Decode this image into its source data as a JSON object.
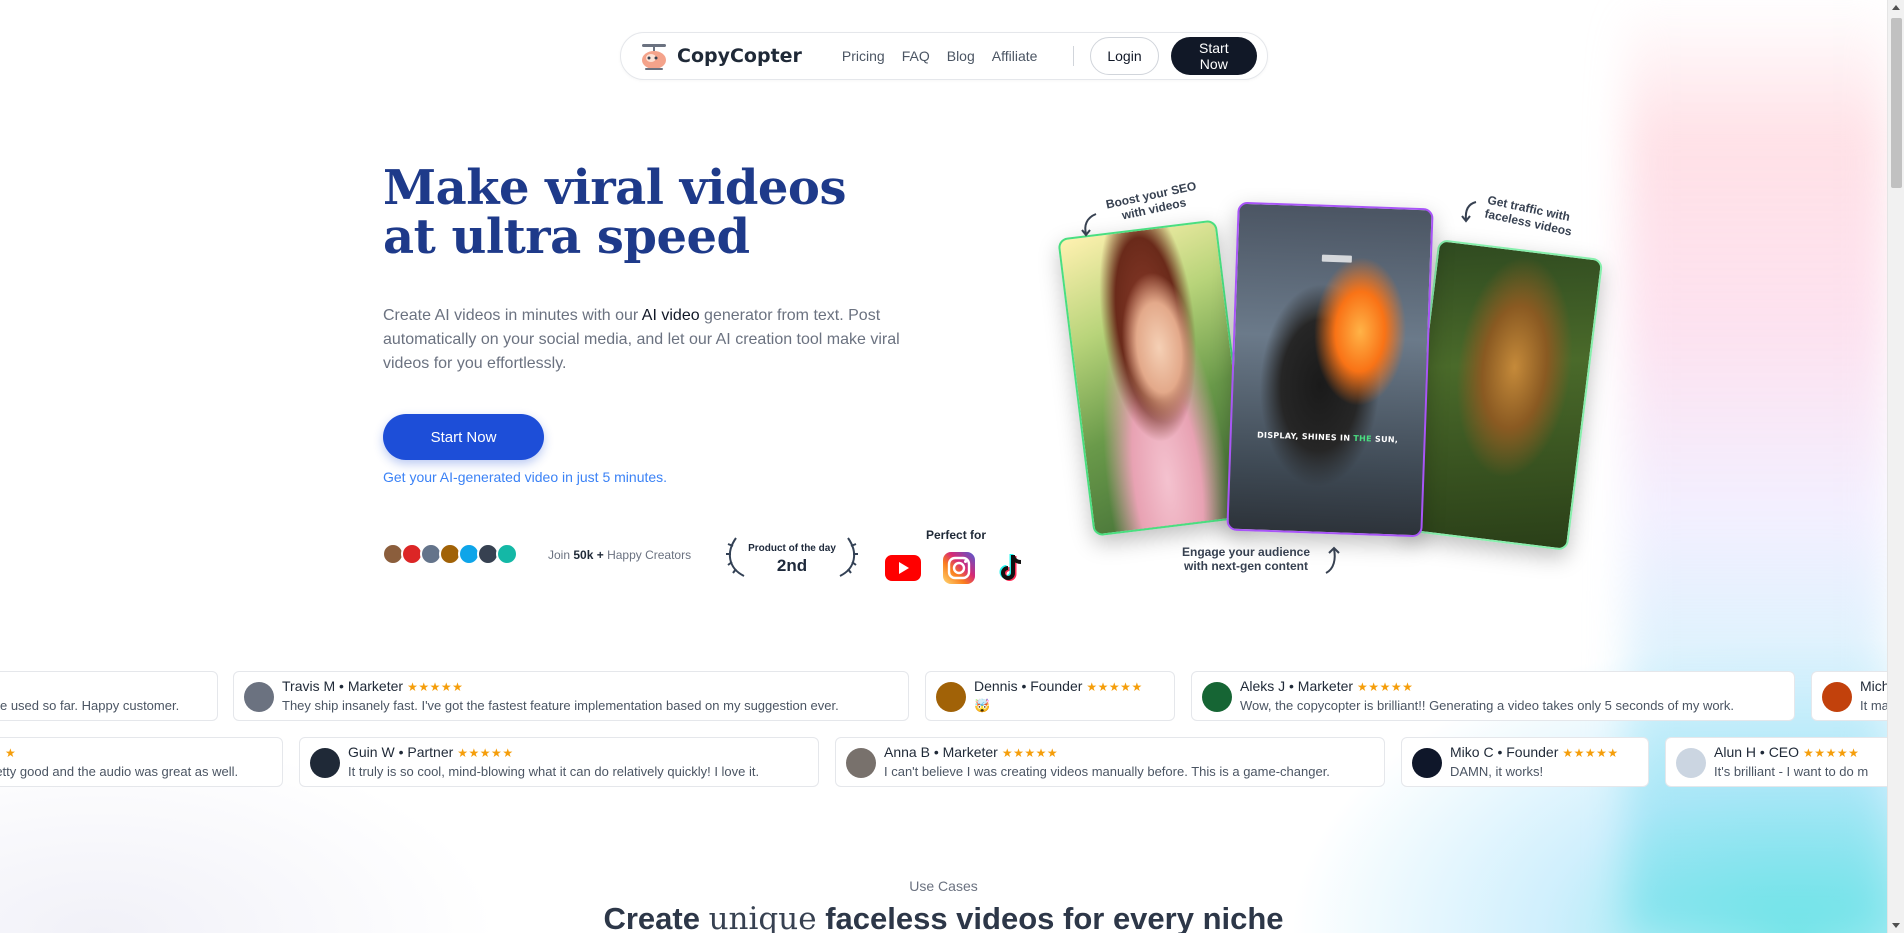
{
  "brand": {
    "name": "CopyCopter"
  },
  "nav": {
    "links": [
      "Pricing",
      "FAQ",
      "Blog",
      "Affiliate"
    ],
    "login": "Login",
    "start": "Start Now"
  },
  "hero": {
    "title_line1": "Make viral videos",
    "title_line2": "at ultra speed",
    "subtitle_pre": "Create AI videos in minutes with our ",
    "subtitle_bold": "AI video",
    "subtitle_post": " generator from text. Post automatically on your social media, and let our AI creation tool make viral videos for you effortlessly.",
    "cta": "Start Now",
    "note": "Get your AI-generated video in just 5 minutes."
  },
  "social_proof": {
    "join_pre": "Join ",
    "join_count": "50k +",
    "join_post": " Happy Creators",
    "potd_label": "Product of the day",
    "potd_rank": "2nd",
    "perfect_for": "Perfect for",
    "platforms": [
      "youtube-icon",
      "instagram-icon",
      "tiktok-icon"
    ]
  },
  "collage": {
    "anno_seo": "Boost your SEO with videos",
    "anno_traffic": "Get traffic with faceless videos",
    "anno_engage_1": "Engage your audience",
    "anno_engage_2": "with next-gen content",
    "caption_pre": "DISPLAY, SHINES IN ",
    "caption_hl": "THE",
    "caption_post": " SUN,"
  },
  "testimonials": {
    "row1": [
      {
        "head": "",
        "text": "'ve used so far. Happy customer."
      },
      {
        "head": "Travis M • Marketer",
        "text": "They ship insanely fast. I've got the fastest feature implementation based on my suggestion ever."
      },
      {
        "head": "Dennis • Founder",
        "text": "🤯"
      },
      {
        "head": "Aleks J • Marketer",
        "text": "Wow, the copycopter is brilliant!! Generating a video takes only 5 seconds of my work."
      },
      {
        "head": "Mich",
        "text": "It ma"
      }
    ],
    "row2": [
      {
        "head": "",
        "text": "retty good and the audio was great as well."
      },
      {
        "head": "Guin W • Partner",
        "text": "It truly is so cool, mind-blowing what it can do relatively quickly! I love it."
      },
      {
        "head": "Anna B • Marketer",
        "text": "I can't believe I was creating videos manually before. This is a game-changer."
      },
      {
        "head": "Miko C • Founder",
        "text": "DAMN, it works!"
      },
      {
        "head": "Alun H • CEO",
        "text": "It's brilliant - I want to do m"
      }
    ],
    "stars": "★★★★★"
  },
  "use_cases": {
    "label": "Use Cases",
    "title_pre": "Create ",
    "title_serif": "unique",
    "title_post": " faceless videos for every niche"
  },
  "colors": {
    "title": "#1e3a8a",
    "cta": "#1d4ed8",
    "nav_dark": "#111827",
    "star": "#f59e0b"
  }
}
